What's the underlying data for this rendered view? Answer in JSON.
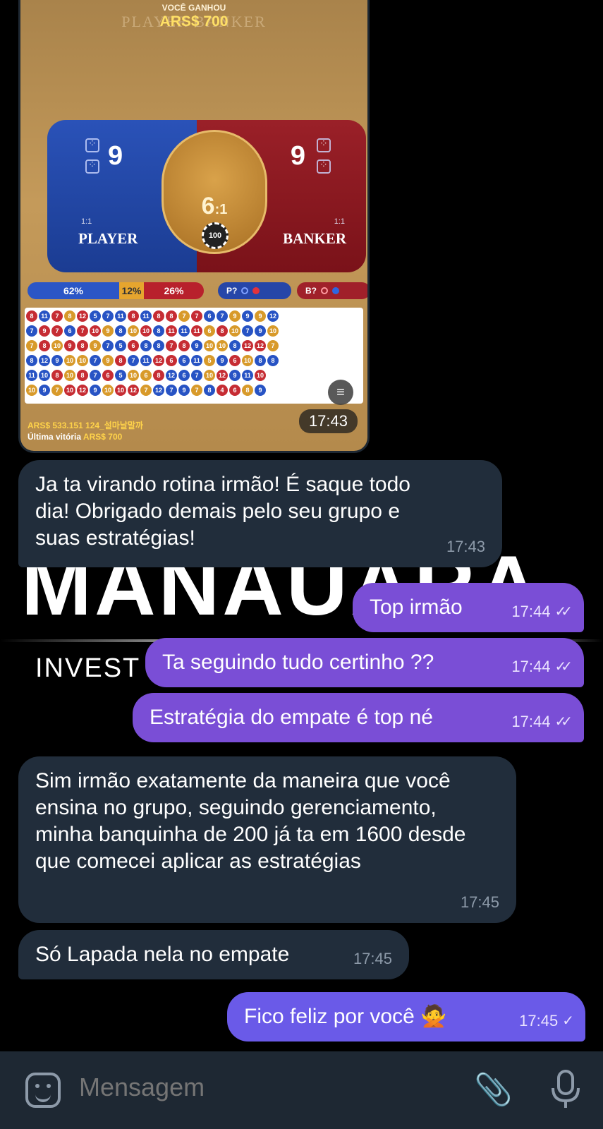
{
  "photo": {
    "banner_small": "VOCÊ GANHOU",
    "banner_ghost": "PLAYER BANKER",
    "banner_amount": "ARS$ 700",
    "player_score": "9",
    "banker_score": "9",
    "player_odds": "1:1",
    "banker_odds": "1:1",
    "player_label": "PLAYER",
    "banker_label": "BANKER",
    "tie_odds_main": "6",
    "tie_odds_suffix": ":1",
    "chip_value": "100",
    "pct_player": "62%",
    "pct_tie": "12%",
    "pct_banker": "26%",
    "pred_player": "P?",
    "pred_banker": "B?",
    "balance": "ARS$ 533.151 124_설마날말까",
    "last_win_label": "Última vitória",
    "last_win_amount": "ARS$ 700",
    "time": "17:43"
  },
  "roadmap": [
    [
      "r",
      "8"
    ],
    [
      "b",
      "11"
    ],
    [
      "r",
      "7"
    ],
    [
      "t",
      "8"
    ],
    [
      "r",
      "12"
    ],
    [
      "b",
      "5"
    ],
    [
      "b",
      "7"
    ],
    [
      "b",
      "11"
    ],
    [
      "r",
      "8"
    ],
    [
      "b",
      "11"
    ],
    [
      "r",
      "8"
    ],
    [
      "r",
      "8"
    ],
    [
      "t",
      "7"
    ],
    [
      "r",
      "7"
    ],
    [
      "b",
      "6"
    ],
    [
      "b",
      "7"
    ],
    [
      "t",
      "9"
    ],
    [
      "b",
      "9"
    ],
    [
      "t",
      "9"
    ],
    [
      "b",
      "12"
    ],
    [
      "",
      ""
    ],
    [
      "",
      ""
    ],
    [
      "",
      ""
    ],
    [
      "",
      ""
    ],
    [
      "",
      ""
    ],
    [
      "b",
      "7"
    ],
    [
      "r",
      "9"
    ],
    [
      "r",
      "7"
    ],
    [
      "b",
      "6"
    ],
    [
      "r",
      "7"
    ],
    [
      "r",
      "10"
    ],
    [
      "t",
      "9"
    ],
    [
      "b",
      "8"
    ],
    [
      "t",
      "10"
    ],
    [
      "r",
      "10"
    ],
    [
      "b",
      "8"
    ],
    [
      "r",
      "11"
    ],
    [
      "b",
      "11"
    ],
    [
      "r",
      "11"
    ],
    [
      "t",
      "6"
    ],
    [
      "r",
      "8"
    ],
    [
      "t",
      "10"
    ],
    [
      "b",
      "7"
    ],
    [
      "b",
      "9"
    ],
    [
      "t",
      "10"
    ],
    [
      "",
      ""
    ],
    [
      "",
      ""
    ],
    [
      "",
      ""
    ],
    [
      "",
      ""
    ],
    [
      "",
      ""
    ],
    [
      "t",
      "7"
    ],
    [
      "r",
      "8"
    ],
    [
      "t",
      "10"
    ],
    [
      "r",
      "9"
    ],
    [
      "r",
      "8"
    ],
    [
      "t",
      "9"
    ],
    [
      "b",
      "7"
    ],
    [
      "b",
      "5"
    ],
    [
      "r",
      "6"
    ],
    [
      "b",
      "8"
    ],
    [
      "b",
      "8"
    ],
    [
      "r",
      "7"
    ],
    [
      "r",
      "8"
    ],
    [
      "b",
      "9"
    ],
    [
      "t",
      "10"
    ],
    [
      "t",
      "10"
    ],
    [
      "b",
      "8"
    ],
    [
      "r",
      "12"
    ],
    [
      "r",
      "12"
    ],
    [
      "t",
      "7"
    ],
    [
      "",
      ""
    ],
    [
      "",
      ""
    ],
    [
      "",
      ""
    ],
    [
      "",
      ""
    ],
    [
      "",
      ""
    ],
    [
      "b",
      "8"
    ],
    [
      "b",
      "12"
    ],
    [
      "b",
      "9"
    ],
    [
      "t",
      "10"
    ],
    [
      "t",
      "10"
    ],
    [
      "b",
      "7"
    ],
    [
      "t",
      "9"
    ],
    [
      "r",
      "8"
    ],
    [
      "b",
      "7"
    ],
    [
      "b",
      "11"
    ],
    [
      "r",
      "12"
    ],
    [
      "r",
      "6"
    ],
    [
      "b",
      "6"
    ],
    [
      "b",
      "11"
    ],
    [
      "t",
      "5"
    ],
    [
      "b",
      "9"
    ],
    [
      "r",
      "6"
    ],
    [
      "t",
      "10"
    ],
    [
      "b",
      "8"
    ],
    [
      "b",
      "8"
    ],
    [
      "",
      ""
    ],
    [
      "",
      ""
    ],
    [
      "",
      ""
    ],
    [
      "",
      ""
    ],
    [
      "",
      ""
    ],
    [
      "b",
      "11"
    ],
    [
      "b",
      "10"
    ],
    [
      "r",
      "8"
    ],
    [
      "t",
      "10"
    ],
    [
      "r",
      "8"
    ],
    [
      "b",
      "7"
    ],
    [
      "r",
      "6"
    ],
    [
      "b",
      "5"
    ],
    [
      "t",
      "10"
    ],
    [
      "t",
      "6"
    ],
    [
      "r",
      "8"
    ],
    [
      "b",
      "12"
    ],
    [
      "b",
      "6"
    ],
    [
      "b",
      "7"
    ],
    [
      "t",
      "10"
    ],
    [
      "r",
      "12"
    ],
    [
      "b",
      "9"
    ],
    [
      "b",
      "11"
    ],
    [
      "r",
      "10"
    ],
    [
      "",
      ""
    ],
    [
      "",
      ""
    ],
    [
      "",
      ""
    ],
    [
      "",
      ""
    ],
    [
      "",
      ""
    ],
    [
      "",
      ""
    ],
    [
      "t",
      "10"
    ],
    [
      "b",
      "9"
    ],
    [
      "t",
      "7"
    ],
    [
      "r",
      "10"
    ],
    [
      "r",
      "12"
    ],
    [
      "b",
      "9"
    ],
    [
      "t",
      "10"
    ],
    [
      "r",
      "10"
    ],
    [
      "r",
      "12"
    ],
    [
      "t",
      "7"
    ],
    [
      "b",
      "12"
    ],
    [
      "b",
      "7"
    ],
    [
      "b",
      "9"
    ],
    [
      "t",
      "7"
    ],
    [
      "b",
      "8"
    ],
    [
      "r",
      "4"
    ],
    [
      "r",
      "6"
    ],
    [
      "t",
      "8"
    ],
    [
      "b",
      "9"
    ],
    [
      "",
      ""
    ],
    [
      "",
      ""
    ],
    [
      "",
      ""
    ],
    [
      "",
      ""
    ],
    [
      "",
      ""
    ],
    [
      "",
      ""
    ]
  ],
  "background": {
    "logo": "MANAUARA",
    "sub": "INVEST"
  },
  "messages": [
    {
      "text": "Ja ta virando rotina irmão! É saque todo dia! Obrigado demais pelo seu grupo e suas estratégias!",
      "time": "17:43"
    },
    {
      "text": "Top irmão",
      "time": "17:44",
      "status": "read"
    },
    {
      "text": "Ta seguindo tudo certinho ??",
      "time": "17:44",
      "status": "read"
    },
    {
      "text": "Estratégia do empate é top né",
      "time": "17:44",
      "status": "read"
    },
    {
      "text": "Sim irmão exatamente da maneira que você ensina no grupo, seguindo gerenciamento, minha banquinha de 200 já ta em 1600 desde que comecei aplicar as estratégias",
      "time": "17:45"
    },
    {
      "text": "Só Lapada nela no empate",
      "time": "17:45"
    },
    {
      "text": "Fico feliz por você 🙅",
      "time": "17:45",
      "status": "sent"
    }
  ],
  "composer": {
    "placeholder": "Mensagem"
  },
  "icons": {
    "read_check": "✓✓",
    "sent_check": "✓",
    "attach": "📎",
    "menu": "≡"
  },
  "colors": {
    "incoming": "#212d3b",
    "outgoing": "#7a4ed6",
    "background": "#000000"
  }
}
